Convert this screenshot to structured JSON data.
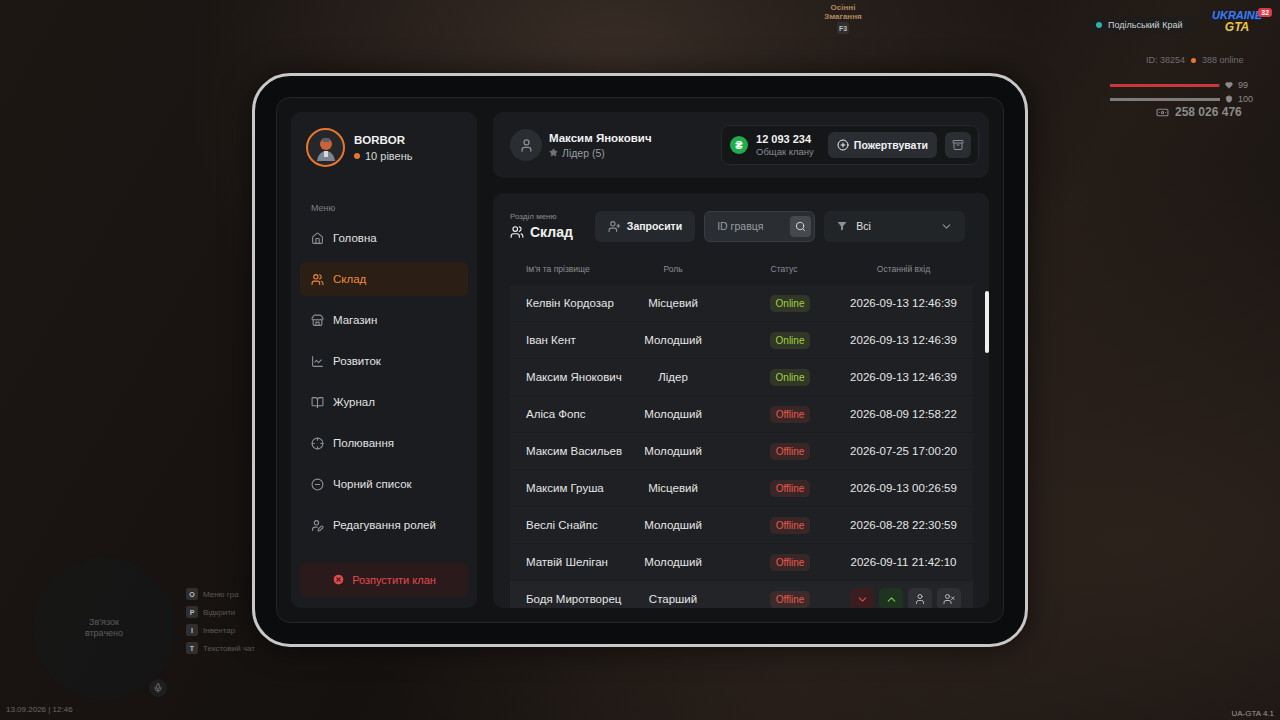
{
  "hud": {
    "region": "Подільський Край",
    "logo": {
      "line1": "UKRAINE",
      "line2": "GTA",
      "badge": "32"
    },
    "id": "ID: 38254",
    "online": "388 online",
    "health": {
      "value": "99",
      "level": 0.99
    },
    "armor": {
      "value": "100",
      "level": 1
    },
    "money": "258 026 476",
    "event": {
      "line1": "Осінні",
      "line2": "Змагання",
      "key": "F3"
    },
    "minimap": {
      "text": "Зв'язок втрачено"
    },
    "hints": [
      {
        "key": "O",
        "label": "Меню гра"
      },
      {
        "key": "P",
        "label": "Відкрити"
      },
      {
        "key": "I",
        "label": "Інвентар"
      },
      {
        "key": "T",
        "label": "Текстовий чат"
      }
    ],
    "datetime": "13.09.2026 | 12:46",
    "version": "UA-GTA 4.1"
  },
  "sidebar": {
    "profile": {
      "name": "BORBOR",
      "level": "10 рівень"
    },
    "menu_label": "Меню",
    "items": [
      {
        "label": "Головна",
        "selected": false
      },
      {
        "label": "Склад",
        "selected": true
      },
      {
        "label": "Магазин",
        "selected": false
      },
      {
        "label": "Розвиток",
        "selected": false
      },
      {
        "label": "Журнал",
        "selected": false
      },
      {
        "label": "Полювання",
        "selected": false
      },
      {
        "label": "Чорний список",
        "selected": false
      },
      {
        "label": "Редагування ролей",
        "selected": false
      }
    ],
    "disband": "Розпустити клан"
  },
  "header": {
    "user": {
      "name": "Максим Янокович",
      "rank": "Лідер (5)"
    },
    "treasury": {
      "currency": "₴",
      "amount": "12 093 234",
      "label": "Общак клану"
    },
    "donate": "Пожертвувати"
  },
  "section": {
    "caption": "Розділ меню",
    "title": "Склад",
    "invite": "Запросити",
    "search": {
      "placeholder": "ID гравця",
      "value": ""
    },
    "filter": {
      "value": "Всі"
    }
  },
  "table": {
    "columns": [
      "Ім'я та прізвище",
      "Роль",
      "Статус",
      "Останній вхід"
    ],
    "row_actions": [
      "demote",
      "promote",
      "profile",
      "kick"
    ],
    "rows": [
      {
        "name": "Келвін Кордозар",
        "role": "Місцевий",
        "status": "Online",
        "online": true,
        "color": "#a3d13f",
        "last_login": "2026-09-13 12:46:39",
        "hovered": false
      },
      {
        "name": "Іван Кент",
        "role": "Молодший",
        "status": "Online",
        "online": true,
        "color": "#a3d13f",
        "last_login": "2026-09-13 12:46:39",
        "hovered": false
      },
      {
        "name": "Максим Янокович",
        "role": "Лідер",
        "status": "Online",
        "online": true,
        "color": "#a3d13f",
        "last_login": "2026-09-13 12:46:39",
        "hovered": false
      },
      {
        "name": "Аліса Фопс",
        "role": "Молодший",
        "status": "Offline",
        "online": false,
        "color": "#e8574a",
        "last_login": "2026-08-09 12:58:22",
        "hovered": false
      },
      {
        "name": "Максим Васильев",
        "role": "Молодший",
        "status": "Offline",
        "online": false,
        "color": "#e8574a",
        "last_login": "2026-07-25 17:00:20",
        "hovered": false
      },
      {
        "name": "Максим Груша",
        "role": "Місцевий",
        "status": "Offline",
        "online": false,
        "color": "#e8574a",
        "last_login": "2026-09-13 00:26:59",
        "hovered": false
      },
      {
        "name": "Веслі Снайпс",
        "role": "Молодший",
        "status": "Offline",
        "online": false,
        "color": "#e8574a",
        "last_login": "2026-08-28 22:30:59",
        "hovered": false
      },
      {
        "name": "Матвій Шеліган",
        "role": "Молодший",
        "status": "Offline",
        "online": false,
        "color": "#e8574a",
        "last_login": "2026-09-11 21:42:10",
        "hovered": false
      },
      {
        "name": "Бодя Миротворец",
        "role": "Старший",
        "status": "Offline",
        "online": false,
        "color": "#e8574a",
        "last_login": "",
        "hovered": true
      }
    ]
  },
  "scrollbar": {
    "thumb": 0.19,
    "position": 0.02
  }
}
